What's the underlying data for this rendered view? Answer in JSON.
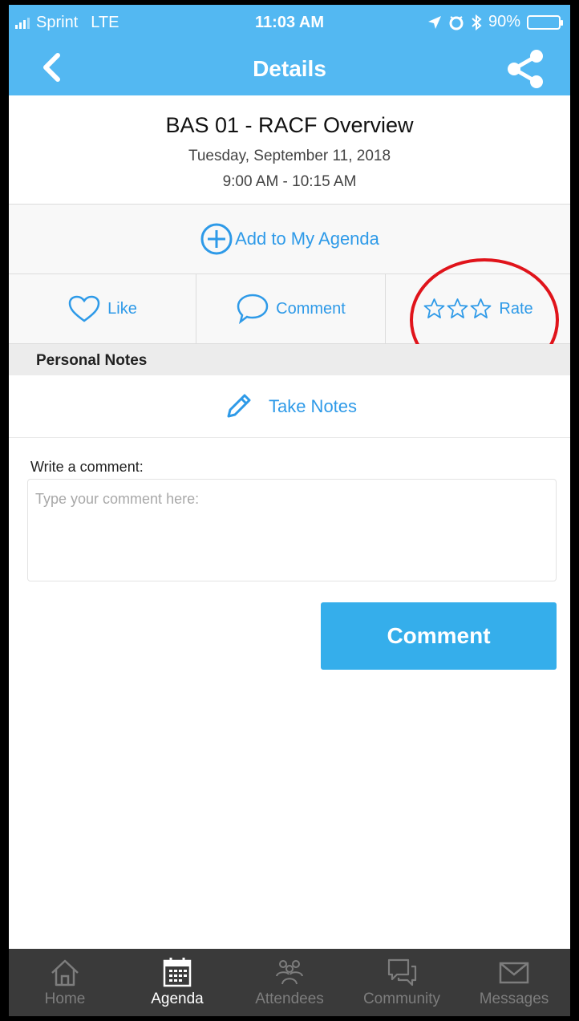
{
  "status_bar": {
    "carrier": "Sprint",
    "network": "LTE",
    "time": "11:03 AM",
    "battery": "90%",
    "battery_level": 0.9
  },
  "nav": {
    "title": "Details",
    "back_icon": "chevron-left-icon",
    "share_icon": "share-icon"
  },
  "session": {
    "title": "BAS 01 - RACF Overview",
    "date": "Tuesday, September 11, 2018",
    "time": "9:00 AM - 10:15 AM"
  },
  "agenda": {
    "label": "Add to My Agenda",
    "icon": "plus-circle-icon"
  },
  "actions": {
    "like": "Like",
    "comment": "Comment",
    "rate": "Rate"
  },
  "notes": {
    "header": "Personal Notes",
    "take_notes": "Take Notes"
  },
  "comment": {
    "label": "Write a comment:",
    "placeholder": "Type your comment here:",
    "value": "",
    "button": "Comment"
  },
  "tabs": [
    {
      "label": "Home",
      "icon": "home-icon",
      "active": false
    },
    {
      "label": "Agenda",
      "icon": "calendar-icon",
      "active": true
    },
    {
      "label": "Attendees",
      "icon": "people-icon",
      "active": false
    },
    {
      "label": "Community",
      "icon": "chat-bubbles-icon",
      "active": false
    },
    {
      "label": "Messages",
      "icon": "envelope-icon",
      "active": false
    }
  ],
  "colors": {
    "accent": "#53b8f2",
    "link": "#2e9ae8",
    "button": "#35aeeb",
    "highlight_circle": "#e0141b",
    "tabbar": "#3a3a3a"
  }
}
